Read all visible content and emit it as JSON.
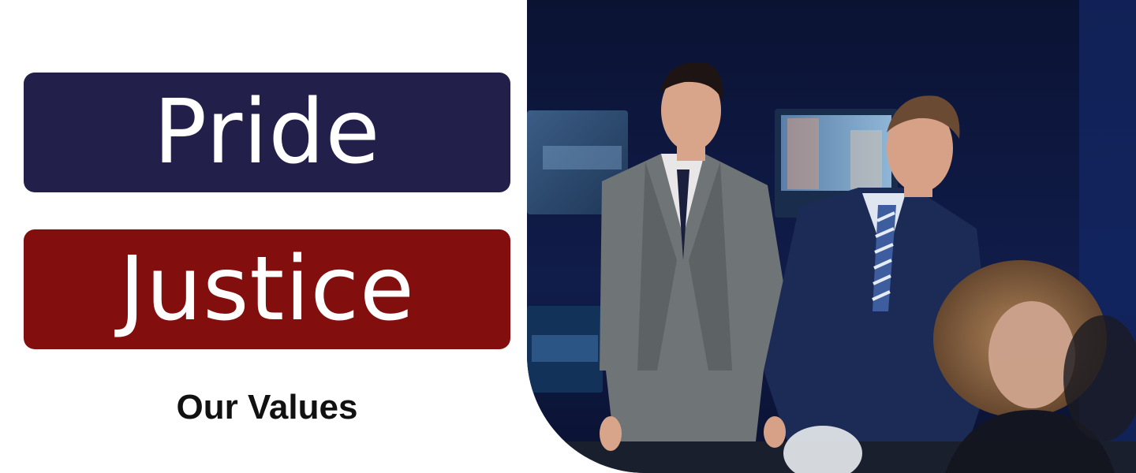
{
  "values": {
    "first": "Pride",
    "second": "Justice"
  },
  "caption": "Our Values",
  "colors": {
    "first_banner": "#221f4a",
    "second_banner": "#820e0e",
    "caption_text": "#111111"
  },
  "photo": {
    "icon": "newsroom-photo"
  }
}
